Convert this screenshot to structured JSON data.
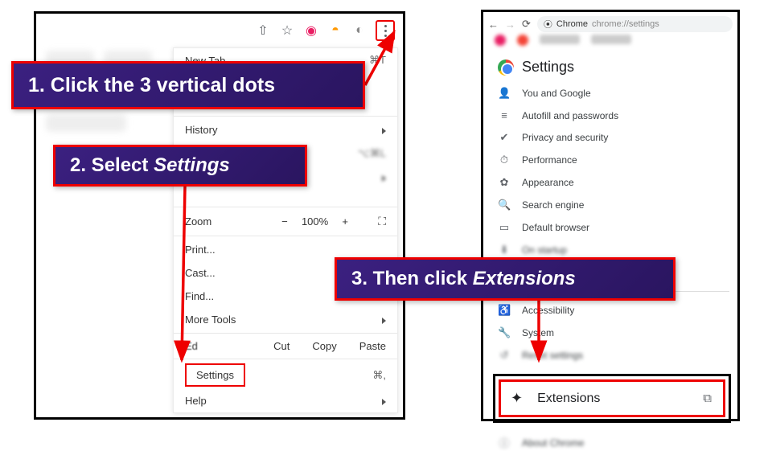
{
  "callouts": {
    "step1": "1.  Click the 3 vertical dots",
    "step2_prefix": "2. Select ",
    "step2_em": "Settings",
    "step3_prefix": "3. Then click ",
    "step3_em": "Extensions"
  },
  "panel1": {
    "menu": {
      "new_tab": "New Tab",
      "new_tab_shortcut": "⌘T",
      "history": "History",
      "downloads_shortcut": "⌥⌘L",
      "zoom_label": "Zoom",
      "zoom_value": "100%",
      "zoom_minus": "−",
      "zoom_plus": "+",
      "print": "Print...",
      "cast": "Cast...",
      "find": "Find...",
      "more_tools": "More Tools",
      "edit_label": "Ed",
      "cut": "Cut",
      "copy": "Copy",
      "paste": "Paste",
      "settings": "Settings",
      "settings_shortcut": "⌘,",
      "help": "Help"
    }
  },
  "panel2": {
    "address": {
      "chrome_label": "Chrome",
      "url": "chrome://settings"
    },
    "heading": "Settings",
    "items": [
      {
        "icon": "👤",
        "label": "You and Google"
      },
      {
        "icon": "≡",
        "label": "Autofill and passwords"
      },
      {
        "icon": "✔",
        "label": "Privacy and security"
      },
      {
        "icon": "⏱",
        "label": "Performance"
      },
      {
        "icon": "✿",
        "label": "Appearance"
      },
      {
        "icon": "🔍",
        "label": "Search engine"
      },
      {
        "icon": "▭",
        "label": "Default browser"
      },
      {
        "icon": "♿",
        "label": "Accessibility"
      },
      {
        "icon": "🔧",
        "label": "System"
      },
      {
        "icon": "↺",
        "label": "Reset settings"
      }
    ],
    "extensions_label": "Extensions"
  },
  "icons": {
    "share": "⇧",
    "star": "☆",
    "back": "←",
    "forward": "→",
    "reload": "⟳",
    "popout": "⧉",
    "puzzle": "✦"
  }
}
